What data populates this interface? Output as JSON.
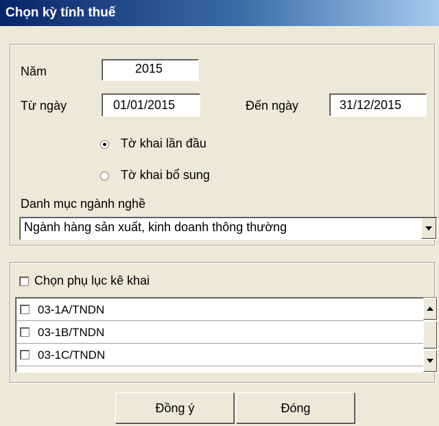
{
  "window": {
    "title": "Chọn kỳ tính thuế"
  },
  "form": {
    "year_label": "Năm",
    "year_value": "2015",
    "from_label": "Từ ngày",
    "from_value": "01/01/2015",
    "to_label": "Đến ngày",
    "to_value": "31/12/2015",
    "radio_first": {
      "label": "Tờ khai lần đầu",
      "selected": true
    },
    "radio_supplement": {
      "label": "Tờ khai bổ sung",
      "selected": false
    },
    "category_label": "Danh mục ngành nghề",
    "category_value": "Ngành hàng sản xuất, kinh doanh thông thường"
  },
  "appendix": {
    "checkbox_label": "Chọn phụ lục kê khai",
    "checked": false,
    "items": [
      {
        "label": "03-1A/TNDN",
        "checked": false
      },
      {
        "label": "03-1B/TNDN",
        "checked": false
      },
      {
        "label": "03-1C/TNDN",
        "checked": false
      }
    ]
  },
  "buttons": {
    "ok": "Đồng ý",
    "close": "Đóng"
  },
  "icons": {
    "dropdown": "chevron-down-icon",
    "scroll_up": "arrow-up-icon",
    "scroll_down": "arrow-down-icon"
  }
}
